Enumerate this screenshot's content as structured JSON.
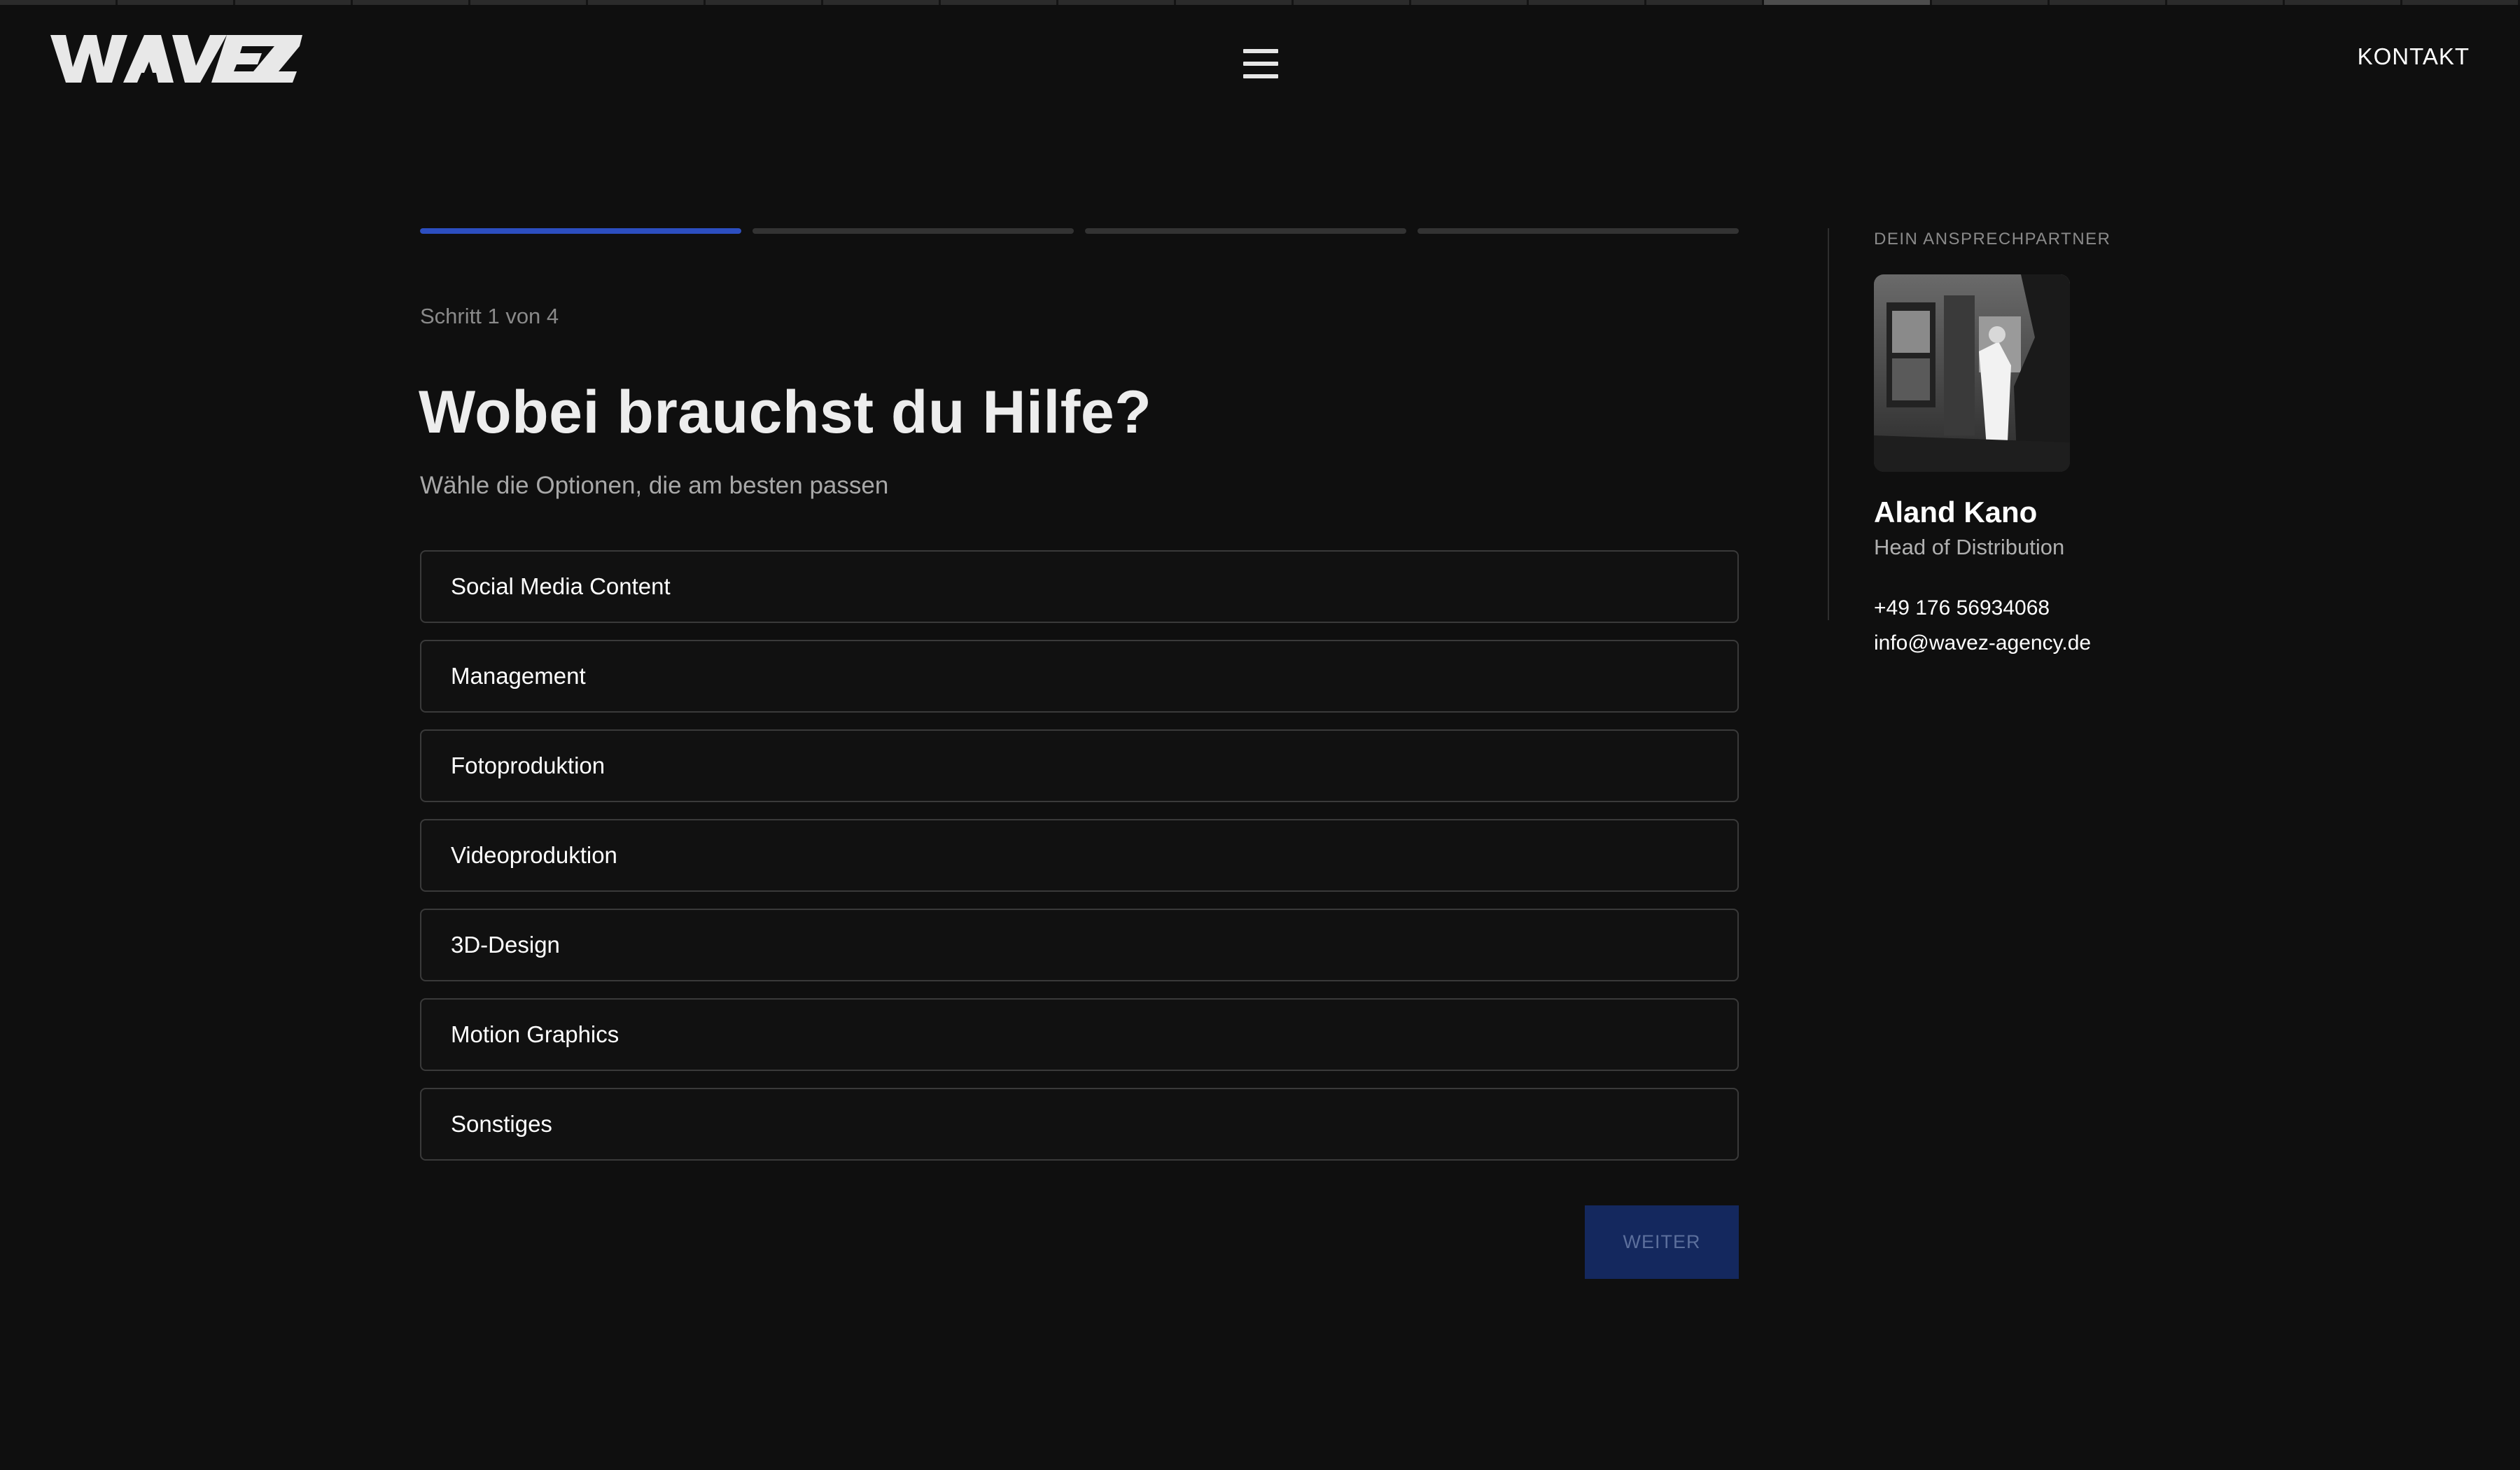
{
  "header": {
    "logo_text": "WAVEZ",
    "menu_icon": "hamburger-menu-icon",
    "kontakt_label": "KONTAKT"
  },
  "top_strip": {
    "segment_count": 21,
    "active_segment_index": 15
  },
  "form": {
    "progress": {
      "total_steps": 4,
      "current_step": 1,
      "active_color": "#2c4ec0",
      "inactive_color": "#333333"
    },
    "step_text": "Schritt 1 von 4",
    "heading": "Wobei brauchst du Hilfe?",
    "subheading": "Wähle die Optionen, die am besten passen",
    "options": [
      {
        "label": "Social Media Content"
      },
      {
        "label": "Management"
      },
      {
        "label": "Fotoproduktion"
      },
      {
        "label": "Videoproduktion"
      },
      {
        "label": "3D-Design"
      },
      {
        "label": "Motion Graphics"
      },
      {
        "label": "Sonstiges"
      }
    ],
    "next_button_label": "WEITER"
  },
  "contact": {
    "section_label": "DEIN ANSPRECHPARTNER",
    "photo_icon": "contact-photo",
    "name": "Aland Kano",
    "role": "Head of Distribution",
    "phone": "+49 176 56934068",
    "email": "info@wavez-agency.de"
  },
  "colors": {
    "background": "#0f0f0f",
    "accent": "#2c4ec0",
    "button_bg": "#14285e",
    "button_text": "#5c6f9c",
    "border": "#3a3a3a"
  }
}
